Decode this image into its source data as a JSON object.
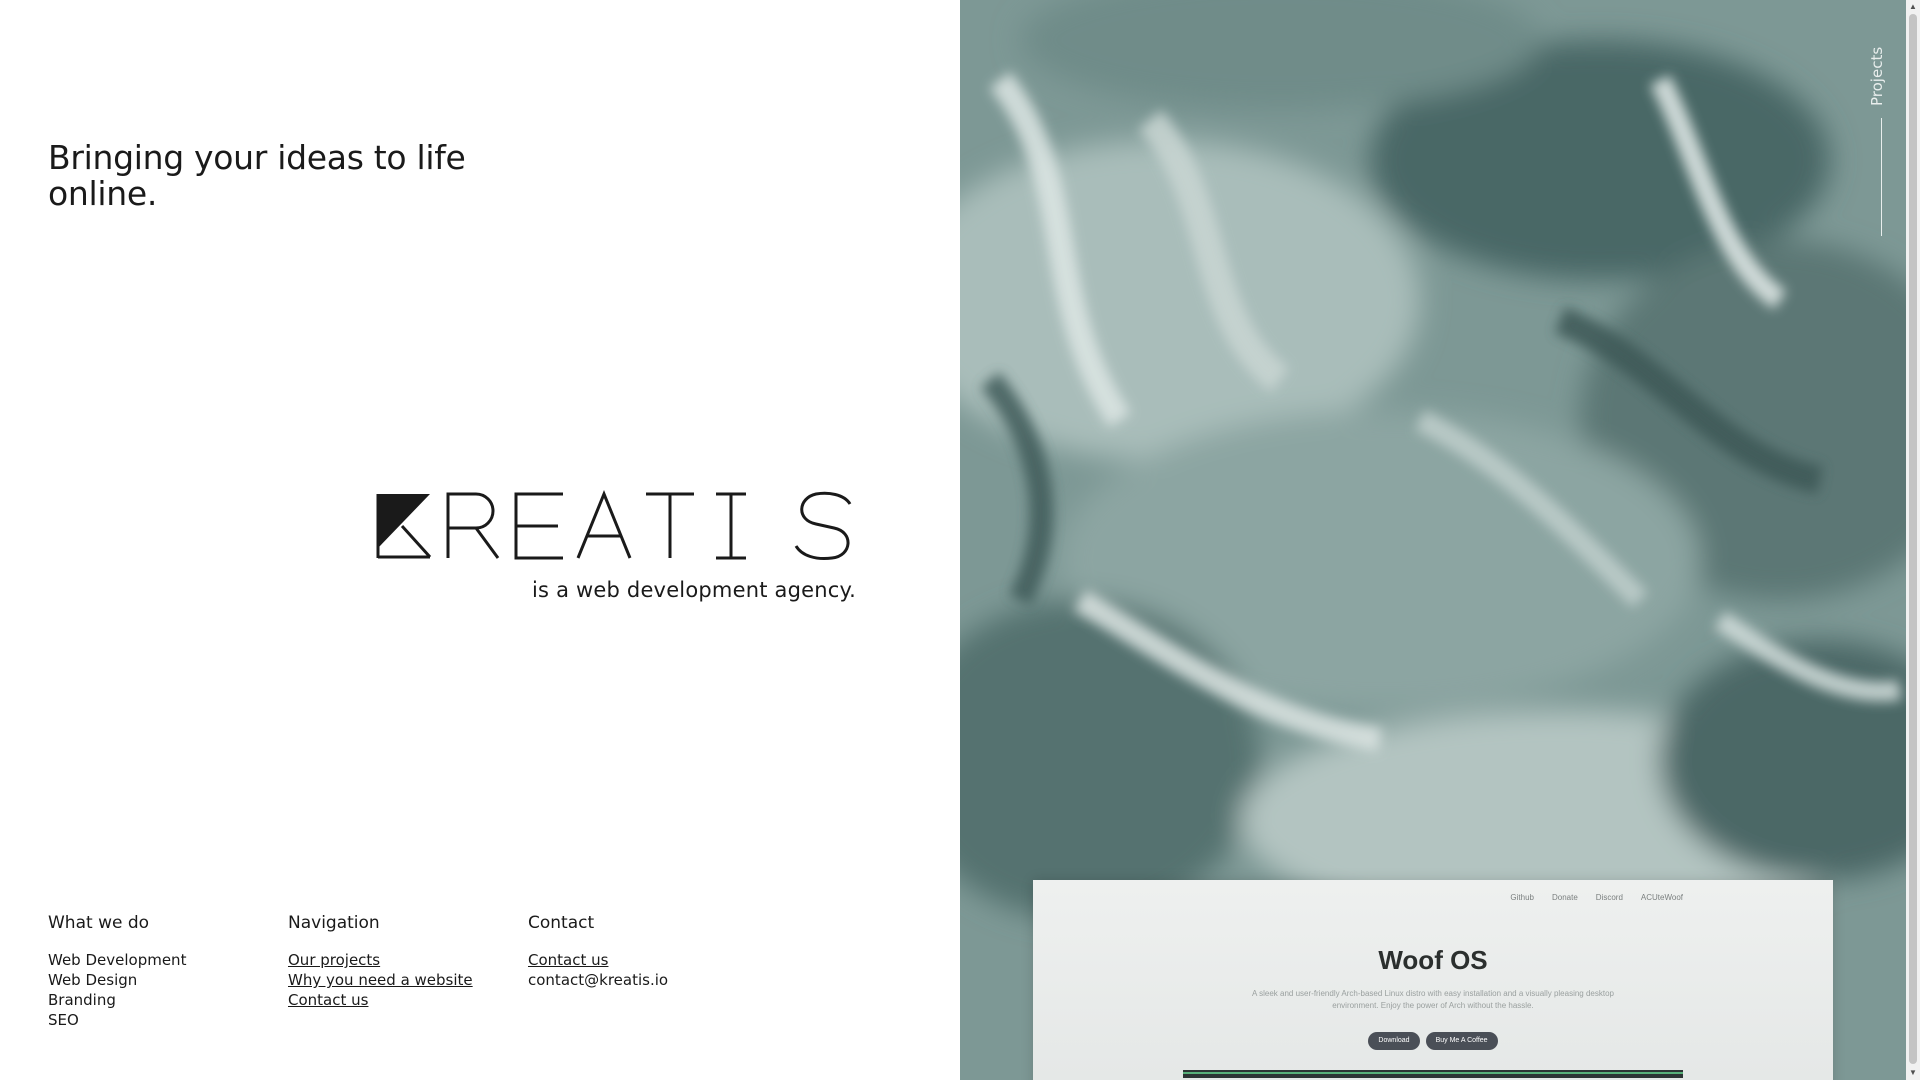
{
  "hero": {
    "tagline": "Bringing your ideas to life online.",
    "brand_wordmark": "KREATIS",
    "brand_sub": "is a web development agency."
  },
  "footer": {
    "what_we_do": {
      "heading": "What we do",
      "items": [
        "Web Development",
        "Web Design",
        "Branding",
        "SEO"
      ]
    },
    "navigation": {
      "heading": "Navigation",
      "links": [
        "Our projects",
        "Why you need a website",
        "Contact us"
      ]
    },
    "contact": {
      "heading": "Contact",
      "link": "Contact us",
      "email": "contact@kreatis.io"
    }
  },
  "side_tab": {
    "label": "Projects"
  },
  "preview": {
    "nav": [
      "Github",
      "Donate",
      "Discord",
      "ACUteWoof"
    ],
    "title": "Woof OS",
    "description": "A sleek and user-friendly Arch-based Linux distro with easy installation and a visually pleasing desktop environment. Enjoy the power of Arch without the hassle.",
    "buttons": [
      "Download",
      "Buy Me A Coffee"
    ]
  },
  "colors": {
    "painting_base": "#7f9a97",
    "painting_dark": "#3f5a5a",
    "painting_light": "#d7e0de",
    "text": "#1a1a1a"
  }
}
